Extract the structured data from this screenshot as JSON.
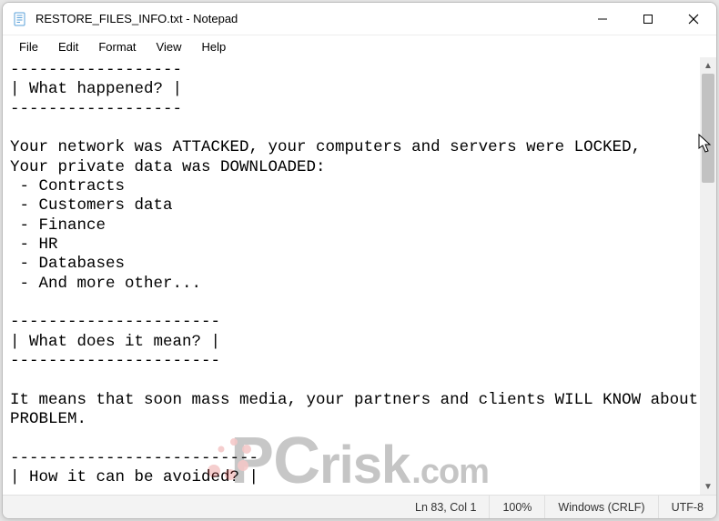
{
  "titlebar": {
    "title": "RESTORE_FILES_INFO.txt - Notepad"
  },
  "menu": {
    "file": "File",
    "edit": "Edit",
    "format": "Format",
    "view": "View",
    "help": "Help"
  },
  "content": {
    "text": "------------------\n| What happened? |\n------------------\n\nYour network was ATTACKED, your computers and servers were LOCKED,\nYour private data was DOWNLOADED:\n - Contracts\n - Customers data\n - Finance\n - HR\n - Databases\n - And more other...\n\n----------------------\n| What does it mean? |\n----------------------\n\nIt means that soon mass media, your partners and clients WILL KNOW about your\nPROBLEM.\n\n--------------------------\n| How it can be avoided? |\n-------------------------- "
  },
  "statusbar": {
    "position": "Ln 83, Col 1",
    "zoom": "100%",
    "lineending": "Windows (CRLF)",
    "encoding": "UTF-8"
  },
  "watermark": {
    "brand_p": "P",
    "brand_c": "C",
    "brand_rest": "risk",
    "domain": ".com"
  }
}
